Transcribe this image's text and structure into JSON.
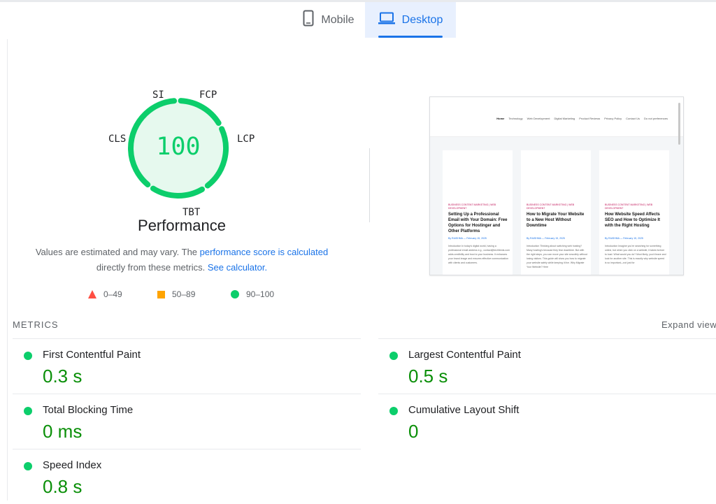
{
  "tabs": [
    {
      "label": "Mobile",
      "icon": "phone-icon",
      "selected": false
    },
    {
      "label": "Desktop",
      "icon": "laptop-icon",
      "selected": true
    }
  ],
  "gauge": {
    "score": "100",
    "title": "Performance",
    "segments": [
      "SI",
      "FCP",
      "LCP",
      "TBT",
      "CLS"
    ],
    "color": "#0cce6b",
    "fill": "#e6f9ee"
  },
  "note": {
    "text1": "Values are estimated and may vary. The ",
    "link1": "performance score is calculated",
    "text2": "directly from these metrics. ",
    "link2": "See calculator."
  },
  "legend": [
    {
      "range": "0–49",
      "color": "#ff4e42",
      "shape": "triangle"
    },
    {
      "range": "50–89",
      "color": "#ffa400",
      "shape": "square"
    },
    {
      "range": "90–100",
      "color": "#0cce6b",
      "shape": "circle"
    }
  ],
  "screenshot": {
    "nav": [
      "Home",
      "Technology",
      "Web Development",
      "Digital Marketing",
      "Product Reviews",
      "Privacy Policy",
      "Contact Us",
      "Do not preferences"
    ],
    "cards": [
      {
        "category": "BUSINESS CONTENT MARKETING | WEB DEVELOPMENT",
        "title": "Setting Up a Professional Email with Your Domain: Free Options for Hostinger and Other Platforms",
        "meta": "By RAISHMA — February 15, 2025",
        "body": "Introduction In today's digital world, having a professional email address e.g., contact@techfeeds.com adds credibility and trust to your business. It enhances your brand image and ensures effective communication with clients and customers."
      },
      {
        "category": "BUSINESS CONTENT MARKETING | WEB DEVELOPMENT",
        "title": "How to Migrate Your Website to a New Host Without Downtime",
        "meta": "By RAISHMA — February 15, 2025",
        "body": "Introduction Thinking about switching web hosting? Many hosting's because they fear downtime. But with the right steps, you can move your site smoothly without losing visitors. This guide will show you how to migrate your website safely while keeping it live. Why Migrate Your Website? Here"
      },
      {
        "category": "BUSINESS CONTENT MARKETING | WEB DEVELOPMENT",
        "title": "How Website Speed Affects SEO and How to Optimize It with the Right Hosting",
        "meta": "By RAISHMA — February 15, 2025",
        "body": "Introduction Imagine you're searching for something online, but when you click on a website, it takes forever to load. What would you do? Most likely, you'd leave and look for another site. This is exactly why website speed is so important—not just for"
      }
    ]
  },
  "metrics": {
    "header": "METRICS",
    "expand": "Expand view",
    "items": [
      {
        "name": "First Contentful Paint",
        "value": "0.3 s"
      },
      {
        "name": "Largest Contentful Paint",
        "value": "0.5 s"
      },
      {
        "name": "Total Blocking Time",
        "value": "0 ms"
      },
      {
        "name": "Cumulative Layout Shift",
        "value": "0"
      },
      {
        "name": "Speed Index",
        "value": "0.8 s"
      }
    ],
    "good_color": "#0cce6b",
    "value_color": "#0a8f08"
  }
}
